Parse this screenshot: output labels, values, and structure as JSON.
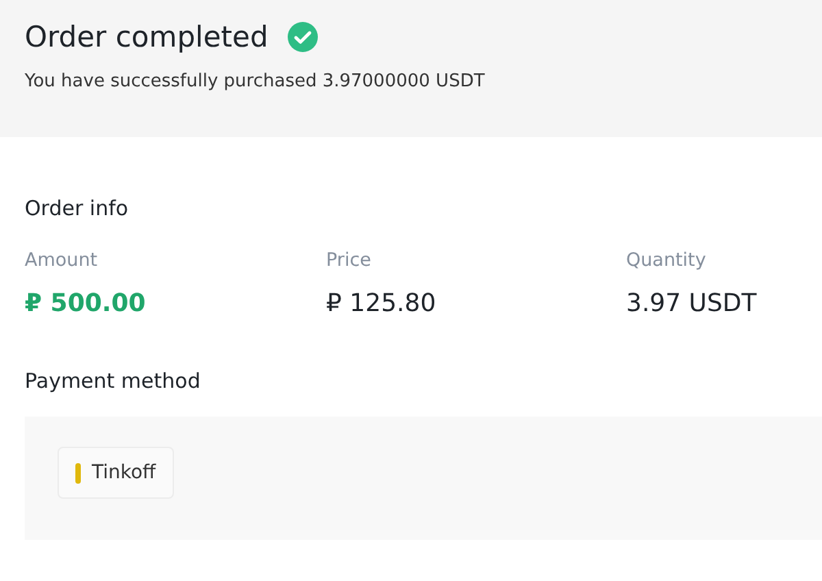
{
  "header": {
    "title": "Order completed",
    "message": "You have successfully purchased 3.97000000 USDT"
  },
  "order_info": {
    "heading": "Order info",
    "fields": [
      {
        "label": "Amount",
        "value": "₽ 500.00",
        "highlighted": true
      },
      {
        "label": "Price",
        "value": "₽ 125.80",
        "highlighted": false
      },
      {
        "label": "Quantity",
        "value": "3.97 USDT",
        "highlighted": false
      }
    ]
  },
  "payment": {
    "heading": "Payment method",
    "methods": [
      {
        "name": "Tinkoff",
        "color": "#e0b80c"
      }
    ]
  }
}
